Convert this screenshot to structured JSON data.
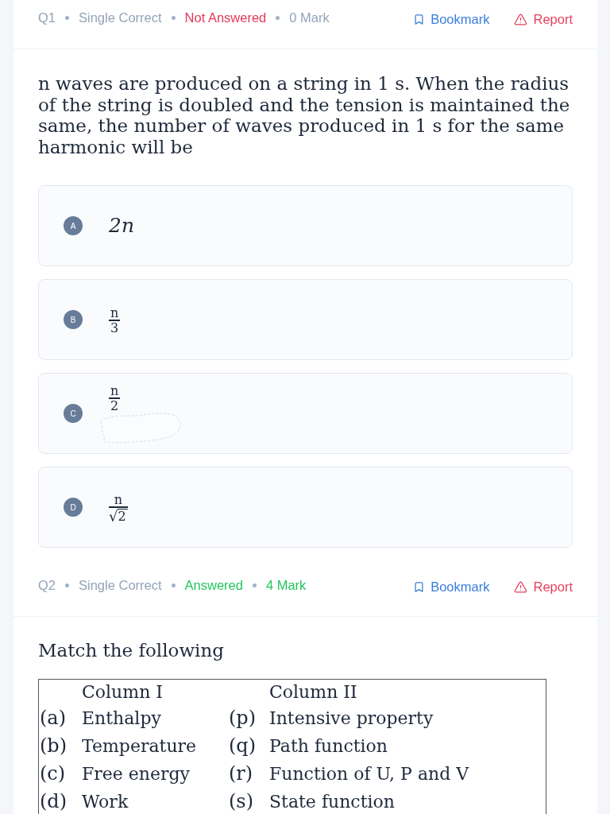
{
  "questions": [
    {
      "number": "Q1",
      "type": "Single Correct",
      "status": "Not Answered",
      "answered": false,
      "marks": "0 Mark",
      "bookmark": "Bookmark",
      "report": "Report",
      "text": "n waves are produced on a string in 1 s. When the radius of the string is doubled and the tension is maintained the same, the number of waves produced in 1 s for the same harmonic will be",
      "options": [
        {
          "label": "A",
          "kind": "math",
          "text": "2n"
        },
        {
          "label": "B",
          "kind": "fraction",
          "numerator": "n",
          "denominator": "3"
        },
        {
          "label": "C",
          "kind": "fraction",
          "numerator": "n",
          "denominator": "2",
          "scribble": true
        },
        {
          "label": "D",
          "kind": "fraction",
          "numerator": "n",
          "denominator": "2",
          "radical": "√"
        }
      ]
    },
    {
      "number": "Q2",
      "type": "Single Correct",
      "status": "Answered",
      "answered": true,
      "marks": "4 Mark",
      "bookmark": "Bookmark",
      "report": "Report",
      "text": "Match the following",
      "match_table": {
        "column_headings": [
          "Column I",
          "Column II"
        ],
        "rows": [
          {
            "left_label": "(a)",
            "left_item": "Enthalpy",
            "right_label": "(p)",
            "right_item": "Intensive property"
          },
          {
            "left_label": "(b)",
            "left_item": "Temperature",
            "right_label": "(q)",
            "right_item": "Path function"
          },
          {
            "left_label": "(c)",
            "left_item": "Free energy",
            "right_label": "(r)",
            "right_item": "Function of U, P and V"
          },
          {
            "left_label": "(d)",
            "left_item": "Work",
            "right_label": "(s)",
            "right_item": "State function"
          }
        ]
      }
    }
  ]
}
